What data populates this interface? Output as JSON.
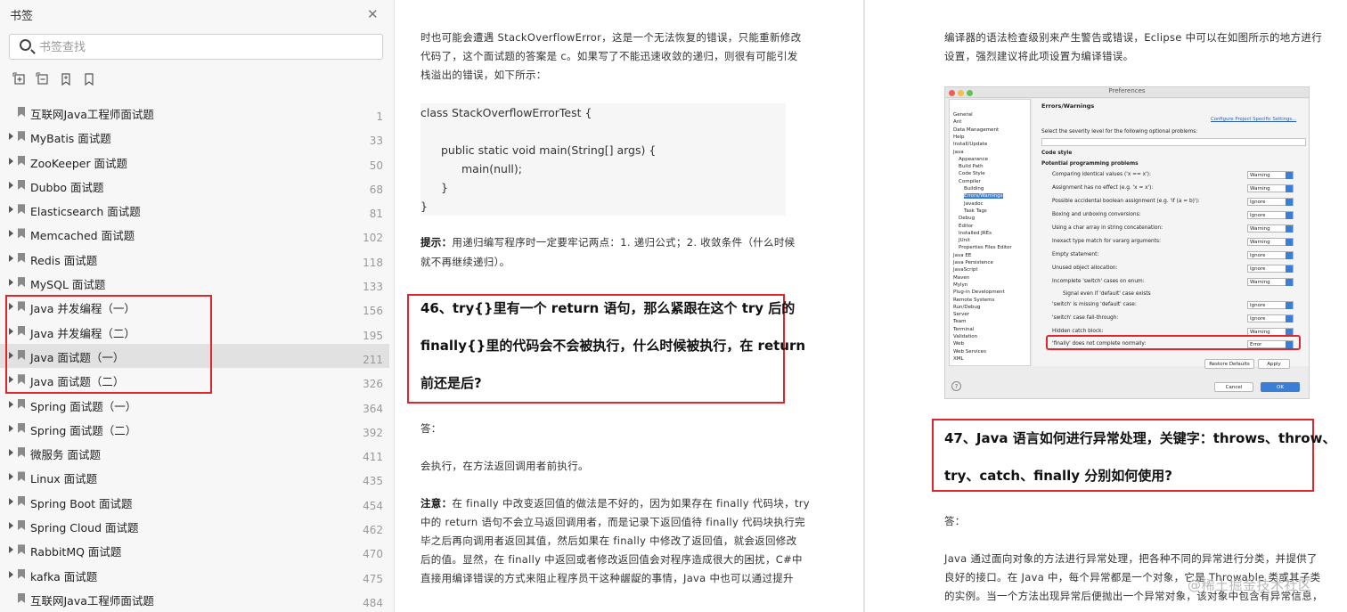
{
  "sidebar": {
    "title": "书签",
    "search_placeholder": "书签查找",
    "items": [
      {
        "label": "互联网Java工程师面试题",
        "page": "1",
        "expandable": false
      },
      {
        "label": "MyBatis 面试题",
        "page": "33",
        "expandable": true
      },
      {
        "label": "ZooKeeper 面试题",
        "page": "50",
        "expandable": true
      },
      {
        "label": "Dubbo 面试题",
        "page": "68",
        "expandable": true
      },
      {
        "label": "Elasticsearch 面试题",
        "page": "81",
        "expandable": true
      },
      {
        "label": "Memcached 面试题",
        "page": "102",
        "expandable": true
      },
      {
        "label": "Redis 面试题",
        "page": "118",
        "expandable": true
      },
      {
        "label": "MySQL 面试题",
        "page": "133",
        "expandable": true
      },
      {
        "label": "Java 并发编程（一）",
        "page": "156",
        "expandable": true
      },
      {
        "label": "Java 并发编程（二）",
        "page": "195",
        "expandable": true
      },
      {
        "label": "Java 面试题（一）",
        "page": "211",
        "expandable": true,
        "selected": true
      },
      {
        "label": "Java 面试题（二）",
        "page": "326",
        "expandable": true
      },
      {
        "label": "Spring 面试题（一）",
        "page": "364",
        "expandable": true
      },
      {
        "label": "Spring 面试题（二）",
        "page": "392",
        "expandable": true
      },
      {
        "label": "微服务 面试题",
        "page": "411",
        "expandable": true
      },
      {
        "label": "Linux 面试题",
        "page": "435",
        "expandable": true
      },
      {
        "label": "Spring Boot 面试题",
        "page": "454",
        "expandable": true
      },
      {
        "label": "Spring Cloud 面试题",
        "page": "462",
        "expandable": true
      },
      {
        "label": "RabbitMQ 面试题",
        "page": "470",
        "expandable": true
      },
      {
        "label": "kafka 面试题",
        "page": "475",
        "expandable": true
      },
      {
        "label": "互联网Java工程师面试题",
        "page": "484",
        "expandable": false
      }
    ]
  },
  "page1": {
    "intro_1": "时也可能会遭遇 StackOverflowError，这是一个无法恢复的错误，只能重新修改",
    "intro_2": "代码了，这个面试题的答案是 c。如果写了不能迅速收敛的递归，则很有可能引发",
    "intro_3": "栈溢出的错误，如下所示：",
    "code": [
      "class StackOverflowErrorTest {",
      "public static void main(String[] args) {",
      "main(null);",
      "}",
      "}"
    ],
    "tip_label": "提示：",
    "tip_1": "用递归编写程序时一定要牢记两点：1. 递归公式；2. 收敛条件（什么时候",
    "tip_2": "就不再继续递归）。",
    "q46_1": "46、try{}里有一个 return 语句，那么紧跟在这个 try 后的",
    "q46_2": "finally{}里的代码会不会被执行，什么时候被执行，在 return",
    "q46_3": "前还是后?",
    "answer_label": "答：",
    "answer": "会执行，在方法返回调用者前执行。",
    "note_label": "注意：",
    "note_1": "在 finally 中改变返回值的做法是不好的，因为如果存在 finally 代码块，try",
    "note_2": "中的 return 语句不会立马返回调用者，而是记录下返回值待 finally 代码块执行完",
    "note_3": "毕之后再向调用者返回其值，然后如果在 finally 中修改了返回值，就会返回修改",
    "note_4": "后的值。显然，在 finally 中返回或者修改返回值会对程序造成很大的困扰，C#中",
    "note_5": "直接用编译错误的方式来阻止程序员干这种龌龊的事情，Java 中也可以通过提升"
  },
  "page2": {
    "intro_1": "编译器的语法检查级别来产生警告或错误，Eclipse 中可以在如图所示的地方进行",
    "intro_2": "设置，强烈建议将此项设置为编译错误。",
    "q47_1": "47、Java 语言如何进行异常处理，关键字：throws、throw、",
    "q47_2": "try、catch、finally 分别如何使用?",
    "answer_label": "答：",
    "ans_1": "Java 通过面向对象的方法进行异常处理，把各种不同的异常进行分类，并提供了",
    "ans_2": "良好的接口。在 Java 中，每个异常都是一个对象，它是 Throwable 类或其子类",
    "ans_3": "的实例。当一个方法出现异常后便抛出一个异常对象，该对象中包含有异常信息，"
  },
  "prefs": {
    "title": "Preferences",
    "tree": [
      "General",
      "Ant",
      "Data Management",
      "Help",
      "Install/Update",
      "Java",
      "Appearance",
      "Build Path",
      "Code Style",
      "Compiler",
      "Building",
      "Errors/Warnings",
      "Javadoc",
      "Task Tags",
      "Debug",
      "Editor",
      "Installed JREs",
      "JUnit",
      "Properties Files Editor",
      "Java EE",
      "Java Persistence",
      "JavaScript",
      "Maven",
      "Mylyn",
      "Plug-in Development",
      "Remote Systems",
      "Run/Debug",
      "Server",
      "Team",
      "Terminal",
      "Validation",
      "Web",
      "Web Services",
      "XML"
    ],
    "heading": "Errors/Warnings",
    "configure_link": "Configure Project Specific Settings...",
    "severity_text": "Select the severity level for the following optional problems:",
    "code_style": "Code style",
    "potential": "Potential programming problems",
    "rows": [
      {
        "label": "Comparing identical values ('x == x'):",
        "value": "Warning"
      },
      {
        "label": "Assignment has no effect (e.g. 'x = x'):",
        "value": "Warning"
      },
      {
        "label": "Possible accidental boolean assignment (e.g. 'if (a = b)'):",
        "value": "Ignore"
      },
      {
        "label": "Boxing and unboxing conversions:",
        "value": "Ignore"
      },
      {
        "label": "Using a char array in string concatenation:",
        "value": "Warning"
      },
      {
        "label": "Inexact type match for vararg arguments:",
        "value": "Warning"
      },
      {
        "label": "Empty statement:",
        "value": "Ignore"
      },
      {
        "label": "Unused object allocation:",
        "value": "Ignore"
      },
      {
        "label": "Incomplete 'switch' cases on enum:",
        "value": "Warning"
      },
      {
        "label": "'switch' is missing 'default' case:",
        "value": "Ignore"
      },
      {
        "label": "'switch' case fall-through:",
        "value": "Ignore"
      },
      {
        "label": "Hidden catch block:",
        "value": "Warning"
      },
      {
        "label": "'finally' does not complete normally:",
        "value": "Error"
      }
    ],
    "signal_text": "Signal even if 'default' case exists",
    "restore": "Restore Defaults",
    "apply": "Apply",
    "cancel": "Cancel",
    "ok": "OK",
    "help": "?"
  },
  "watermark": "@稀土掘金技术社区",
  "colors": {
    "highlight_box": "#e0262d",
    "selection": "#e1e1e1",
    "mac_blue": "#3b7ed6"
  }
}
